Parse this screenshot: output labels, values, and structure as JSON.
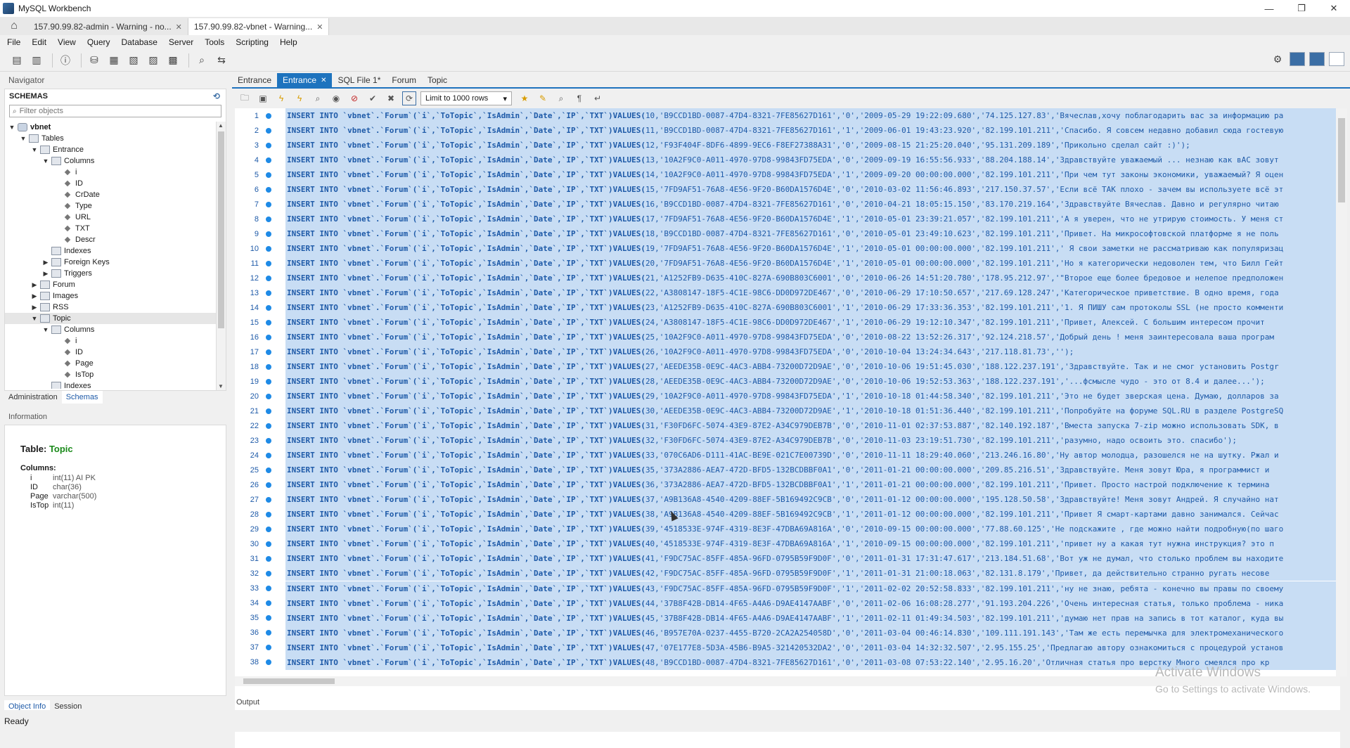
{
  "window": {
    "title": "MySQL Workbench",
    "controls": [
      "—",
      "❐",
      "✕"
    ]
  },
  "connection_tabs": [
    {
      "label": "157.90.99.82-admin - Warning - no...",
      "active": false
    },
    {
      "label": "157.90.99.82-vbnet - Warning...",
      "active": true
    }
  ],
  "menu": [
    "File",
    "Edit",
    "View",
    "Query",
    "Database",
    "Server",
    "Tools",
    "Scripting",
    "Help"
  ],
  "navigator": {
    "header": "Navigator",
    "schemas_title": "SCHEMAS",
    "filter_placeholder": "Filter objects",
    "tree": [
      {
        "level": 0,
        "toggle": "▼",
        "icon": "db",
        "label": "vbnet",
        "bold": true
      },
      {
        "level": 1,
        "toggle": "▼",
        "icon": "folder",
        "label": "Tables"
      },
      {
        "level": 2,
        "toggle": "▼",
        "icon": "table",
        "label": "Entrance"
      },
      {
        "level": 3,
        "toggle": "▼",
        "icon": "folder",
        "label": "Columns"
      },
      {
        "level": 4,
        "toggle": "",
        "icon": "dot",
        "label": "i"
      },
      {
        "level": 4,
        "toggle": "",
        "icon": "dot",
        "label": "ID"
      },
      {
        "level": 4,
        "toggle": "",
        "icon": "dot",
        "label": "CrDate"
      },
      {
        "level": 4,
        "toggle": "",
        "icon": "dot",
        "label": "Type"
      },
      {
        "level": 4,
        "toggle": "",
        "icon": "dot",
        "label": "URL"
      },
      {
        "level": 4,
        "toggle": "",
        "icon": "dot",
        "label": "TXT"
      },
      {
        "level": 4,
        "toggle": "",
        "icon": "dot",
        "label": "Descr"
      },
      {
        "level": 3,
        "toggle": "",
        "icon": "folder",
        "label": "Indexes"
      },
      {
        "level": 3,
        "toggle": "▶",
        "icon": "folder",
        "label": "Foreign Keys"
      },
      {
        "level": 3,
        "toggle": "▶",
        "icon": "folder",
        "label": "Triggers"
      },
      {
        "level": 2,
        "toggle": "▶",
        "icon": "table",
        "label": "Forum"
      },
      {
        "level": 2,
        "toggle": "▶",
        "icon": "table",
        "label": "Images"
      },
      {
        "level": 2,
        "toggle": "▶",
        "icon": "table",
        "label": "RSS"
      },
      {
        "level": 2,
        "toggle": "▼",
        "icon": "table",
        "label": "Topic",
        "selected": true
      },
      {
        "level": 3,
        "toggle": "▼",
        "icon": "folder",
        "label": "Columns"
      },
      {
        "level": 4,
        "toggle": "",
        "icon": "dot",
        "label": "i"
      },
      {
        "level": 4,
        "toggle": "",
        "icon": "dot",
        "label": "ID"
      },
      {
        "level": 4,
        "toggle": "",
        "icon": "dot",
        "label": "Page"
      },
      {
        "level": 4,
        "toggle": "",
        "icon": "dot",
        "label": "IsTop"
      },
      {
        "level": 3,
        "toggle": "",
        "icon": "folder",
        "label": "Indexes"
      }
    ],
    "sub_tabs": [
      {
        "label": "Administration",
        "active": false
      },
      {
        "label": "Schemas",
        "active": true
      }
    ],
    "info_header": "Information",
    "info": {
      "table_label": "Table:",
      "table_name": "Topic",
      "columns_label": "Columns:",
      "columns": [
        {
          "name": "i",
          "type": "int(11) AI PK"
        },
        {
          "name": "ID",
          "type": "char(36)"
        },
        {
          "name": "Page",
          "type": "varchar(500)"
        },
        {
          "name": "IsTop",
          "type": "int(11)"
        }
      ]
    },
    "bottom_tabs": [
      {
        "label": "Object Info",
        "active": true
      },
      {
        "label": "Session",
        "active": false
      }
    ]
  },
  "editor": {
    "tabs": [
      {
        "label": "Entrance",
        "active": false,
        "closable": false
      },
      {
        "label": "Entrance",
        "active": true,
        "closable": true
      },
      {
        "label": "SQL File 1*",
        "active": false,
        "closable": false
      },
      {
        "label": "Forum",
        "active": false,
        "closable": false
      },
      {
        "label": "Topic",
        "active": false,
        "closable": false
      }
    ],
    "limit_label": "Limit to 1000 rows",
    "output_label": "Output",
    "prefix": "INSERT INTO `vbnet`.`Forum`(`i`,`ToTopic`,`IsAdmin`,`Date`,`IP`,`TXT`)VALUES(",
    "rows": [
      {
        "n": "1",
        "v": "10,'B9CCD1BD-0087-47D4-8321-7FE85627D161','0','2009-05-29 19:22:09.680','74.125.127.83','Вячеслав,хочу поблагодарить вас за информацию ра"
      },
      {
        "n": "2",
        "v": "11,'B9CCD1BD-0087-47D4-8321-7FE85627D161','1','2009-06-01 19:43:23.920','82.199.101.211','Спасибо. Я совсем недавно добавил сюда гостевую"
      },
      {
        "n": "3",
        "v": "12,'F93F404F-8DF6-4899-9EC6-F8EF27388A31','0','2009-08-15 21:25:20.040','95.131.209.189','Прикольно сделал сайт :)');"
      },
      {
        "n": "4",
        "v": "13,'10A2F9C0-A011-4970-97D8-99843FD75EDA','0','2009-09-19 16:55:56.933','88.204.188.14','Здравствуйте уважаемый ... незнаю как вАС зовут"
      },
      {
        "n": "5",
        "v": "14,'10A2F9C0-A011-4970-97D8-99843FD75EDA','1','2009-09-20 00:00:00.000','82.199.101.211','При чем тут законы экономики, уважаемый? Я оцен"
      },
      {
        "n": "6",
        "v": "15,'7FD9AF51-76A8-4E56-9F20-B60DA1576D4E','0','2010-03-02 11:56:46.893','217.150.37.57','Если всё ТАК плохо - зачем вы используете всё эт"
      },
      {
        "n": "7",
        "v": "16,'B9CCD1BD-0087-47D4-8321-7FE85627D161','0','2010-04-21 18:05:15.150','83.170.219.164','Здравствуйте Вячеслав. Давно и регулярно читаю"
      },
      {
        "n": "8",
        "v": "17,'7FD9AF51-76A8-4E56-9F20-B60DA1576D4E','1','2010-05-01 23:39:21.057','82.199.101.211','А я уверен, что не утрирую стоимость. У меня ст"
      },
      {
        "n": "9",
        "v": "18,'B9CCD1BD-0087-47D4-8321-7FE85627D161','0','2010-05-01 23:49:10.623','82.199.101.211','Привет.  На микрософтовской платформе я не поль"
      },
      {
        "n": "10",
        "v": "19,'7FD9AF51-76A8-4E56-9F20-B60DA1576D4E','1','2010-05-01 00:00:00.000','82.199.101.211',' Я свои заметки не рассматриваю как популяризац"
      },
      {
        "n": "11",
        "v": "20,'7FD9AF51-76A8-4E56-9F20-B60DA1576D4E','1','2010-05-01 00:00:00.000','82.199.101.211','Но я категорически недоволен тем, что Билл Гейт"
      },
      {
        "n": "12",
        "v": "21,'A1252FB9-D635-410C-827A-690B803C6001','0','2010-06-26 14:51:20.780','178.95.212.97','\"Второе еще более бредовое и нелепое предположен"
      },
      {
        "n": "13",
        "v": "22,'A3808147-18F5-4C1E-98C6-DD0D972DE467','0','2010-06-29 17:10:50.657','217.69.128.247','Категорическое приветствие.  В одно время, года"
      },
      {
        "n": "14",
        "v": "23,'A1252FB9-D635-410C-827A-690B803C6001','1','2010-06-29 17:33:36.353','82.199.101.211','1. Я ПИШУ сам протоколы SSL (не просто комменти"
      },
      {
        "n": "15",
        "v": "24,'A3808147-18F5-4C1E-98C6-DD0D972DE467','1','2010-06-29 19:12:10.347','82.199.101.211','Привет, Алексей.    С большим интересом прочит"
      },
      {
        "n": "16",
        "v": "25,'10A2F9C0-A011-4970-97D8-99843FD75EDA','0','2010-08-22 13:52:26.317','92.124.218.57','Добрый день !  меня заинтересовала ваша програм"
      },
      {
        "n": "17",
        "v": "26,'10A2F9C0-A011-4970-97D8-99843FD75EDA','0','2010-10-04 13:24:34.643','217.118.81.73','');"
      },
      {
        "n": "18",
        "v": "27,'AEEDE35B-0E9C-4AC3-ABB4-73200D72D9AE','0','2010-10-06 19:51:45.030','188.122.237.191','Здравствуйте.  Так и не смог установить Postgr"
      },
      {
        "n": "19",
        "v": "28,'AEEDE35B-0E9C-4AC3-ABB4-73200D72D9AE','0','2010-10-06 19:52:53.363','188.122.237.191','...фсмысле чудо - это от 8.4 и далее...');"
      },
      {
        "n": "20",
        "v": "29,'10A2F9C0-A011-4970-97D8-99843FD75EDA','1','2010-10-18 01:44:58.340','82.199.101.211','Это не будет зверская цена. Думаю, долларов за"
      },
      {
        "n": "21",
        "v": "30,'AEEDE35B-0E9C-4AC3-ABB4-73200D72D9AE','1','2010-10-18 01:51:36.440','82.199.101.211','Попробуйте на форуме SQL.RU в разделе PostgreSQ"
      },
      {
        "n": "22",
        "v": "31,'F30FD6FC-5074-43E9-87E2-A34C979DEB7B','0','2010-11-01 02:37:53.887','82.140.192.187','Вместа запуска 7-zip можно использовать SDK, в"
      },
      {
        "n": "23",
        "v": "32,'F30FD6FC-5074-43E9-87E2-A34C979DEB7B','0','2010-11-03 23:19:51.730','82.199.101.211','разумно, надо освоить это. спасибо');"
      },
      {
        "n": "24",
        "v": "33,'070C6AD6-D111-41AC-BE9E-021C7E00739D','0','2010-11-11 18:29:40.060','213.246.16.80','Ну автор молодца, разошелся не на шутку. Ржал и"
      },
      {
        "n": "25",
        "v": "35,'373A2886-AEA7-472D-BFD5-132BCDBBF0A1','0','2011-01-21 00:00:00.000','209.85.216.51','Здравствуйте.    Меня зовут Юра, я программист и"
      },
      {
        "n": "26",
        "v": "36,'373A2886-AEA7-472D-BFD5-132BCDBBF0A1','1','2011-01-21 00:00:00.000','82.199.101.211','Привет.    Просто настрой подключение к термина"
      },
      {
        "n": "27",
        "v": "37,'A9B136A8-4540-4209-88EF-5B169492C9CB','0','2011-01-12 00:00:00.000','195.128.50.58','Здравствуйте!  Меня зовут Андрей. Я случайно нат"
      },
      {
        "n": "28",
        "v": "38,'A9B136A8-4540-4209-88EF-5B169492C9CB','1','2011-01-12 00:00:00.000','82.199.101.211','Привет  Я смарт-картами давно занимался. Сейчас"
      },
      {
        "n": "29",
        "v": "39,'4518533E-974F-4319-8E3F-47DBA69A816A','0','2010-09-15 00:00:00.000','77.88.60.125','Не подскажите , где можно найти подробную(по шаго"
      },
      {
        "n": "30",
        "v": "40,'4518533E-974F-4319-8E3F-47DBA69A816A','1','2010-09-15 00:00:00.000','82.199.101.211','привет  ну а какая тут нужна инструкция?  это п"
      },
      {
        "n": "31",
        "v": "41,'F9DC75AC-85FF-485A-96FD-0795B59F9D0F','0','2011-01-31 17:31:47.617','213.184.51.68','Вот уж не думал, что столько проблем вы находите"
      },
      {
        "n": "32",
        "v": "42,'F9DC75AC-85FF-485A-96FD-0795B59F9D0F','1','2011-01-31 21:00:18.063','82.131.8.179','Привет,    да действительно странно ругать  несове"
      },
      {
        "n": "33",
        "v": "43,'F9DC75AC-85FF-485A-96FD-0795B59F9D0F','1','2011-02-02 20:52:58.833','82.199.101.211','ну не знаю, ребята - конечно вы правы по своему"
      },
      {
        "n": "34",
        "v": "44,'37B8F42B-DB14-4F65-A4A6-D9AE4147AABF','0','2011-02-06 16:08:28.277','91.193.204.226','Очень интересная статья, только проблема - ника"
      },
      {
        "n": "35",
        "v": "45,'37B8F42B-DB14-4F65-A4A6-D9AE4147AABF','1','2011-02-11 01:49:34.503','82.199.101.211','думаю нет прав на запись в тот каталог, куда вы"
      },
      {
        "n": "36",
        "v": "46,'B957E70A-0237-4455-B720-2CA2A254058D','0','2011-03-04 00:46:14.830','109.111.191.143','Там же есть перемычка для электромеханического"
      },
      {
        "n": "37",
        "v": "47,'07E177E8-5D3A-45B6-B9A5-321420532DA2','0','2011-03-04 14:32:32.507','2.95.155.25','Предлагаю автору ознакомиться с процедурой установ"
      },
      {
        "n": "38",
        "v": "48,'B9CCD1BD-0087-47D4-8321-7FE85627D161','0','2011-03-08 07:53:22.140','2.95.16.20','Отличная статья про верстку   Много смеялся про кр"
      }
    ]
  },
  "watermark": {
    "line1": "Activate Windows",
    "line2": "Go to Settings to activate Windows."
  },
  "status": "Ready"
}
